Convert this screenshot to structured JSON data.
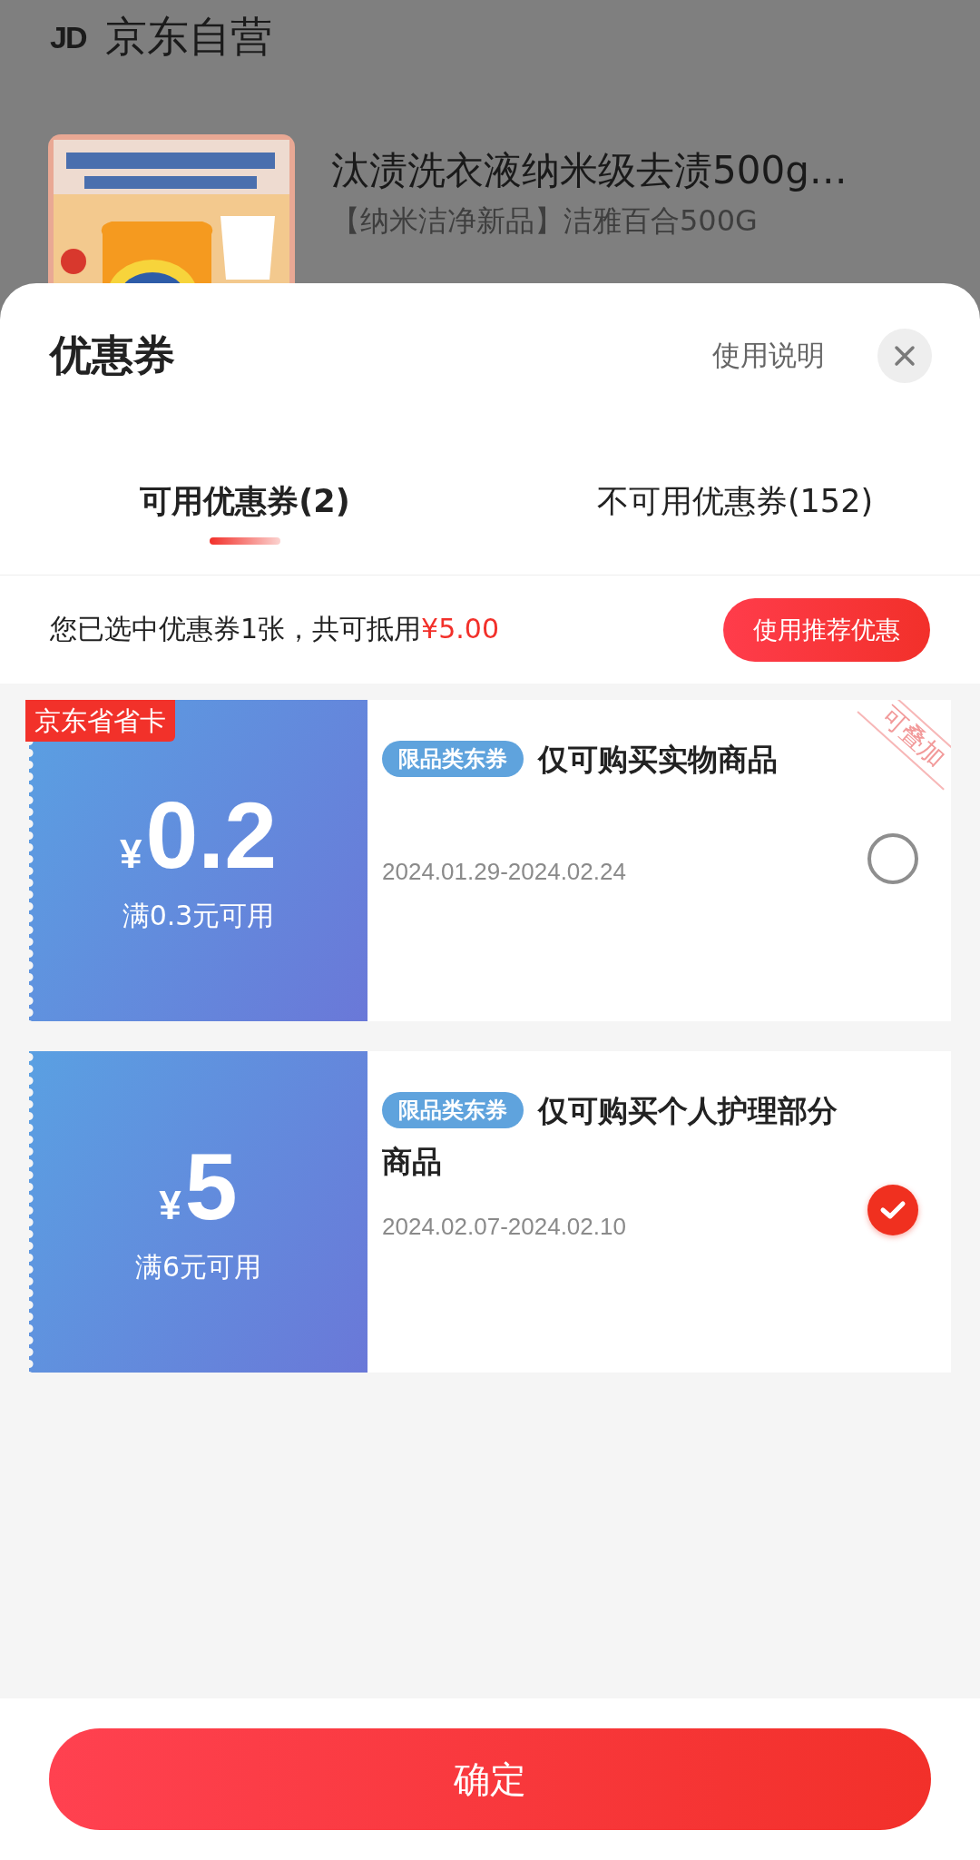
{
  "store": {
    "logo": "JD",
    "name": "京东自营"
  },
  "product": {
    "title": "汰渍洗衣液纳米级去渍500g…",
    "subtitle": "【纳米洁净新品】洁雅百合500G"
  },
  "sheet": {
    "title": "优惠券",
    "help_link": "使用说明",
    "tabs": [
      {
        "label": "可用优惠券(2)",
        "selected": true
      },
      {
        "label": "不可用优惠券(152)",
        "selected": false
      }
    ],
    "summary": {
      "text": "您已选中优惠券1张，共可抵用",
      "amount": "¥5.00"
    },
    "recommend_button": "使用推荐优惠",
    "coupons": [
      {
        "badge": "京东省省卡",
        "currency": "¥",
        "amount": "0.2",
        "condition": "满0.3元可用",
        "tag": "限品类东券",
        "title": "仅可购买实物商品",
        "validity": "2024.01.29-2024.02.24",
        "stamp": "可叠加",
        "selected": false
      },
      {
        "currency": "¥",
        "amount": "5",
        "condition": "满6元可用",
        "tag": "限品类东券",
        "title": "仅可购买个人护理部分商品",
        "validity": "2024.02.07-2024.02.10",
        "selected": true
      }
    ],
    "confirm_button": "确定"
  }
}
